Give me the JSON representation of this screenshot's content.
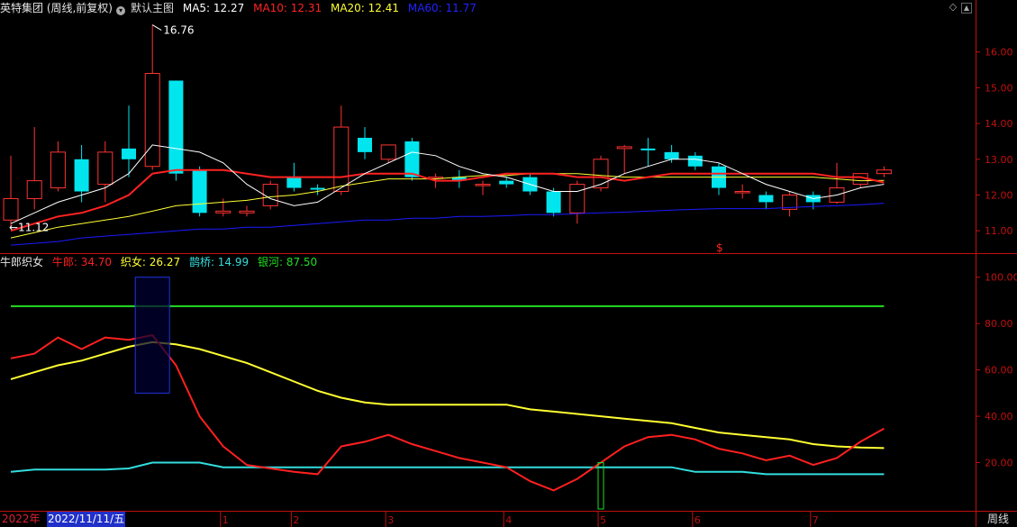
{
  "header": {
    "stock_name": "英特集团 (周线,前复权)",
    "chart_label": "默认主图",
    "ma5": "MA5: 12.27",
    "ma10": "MA10: 12.31",
    "ma20": "MA20: 12.41",
    "ma60": "MA60: 11.77"
  },
  "indicator_header": {
    "name": "牛郎织女",
    "niulang": "牛郎: 34.70",
    "zhinv": "织女: 26.27",
    "queqiao": "鹊桥: 14.99",
    "yinhe": "银河: 87.50"
  },
  "footer": {
    "start_label": "2022年",
    "cursor_date": "2022/11/11/五",
    "period_label": "周线",
    "month_ticks": [
      "1",
      "2",
      "3",
      "4",
      "5",
      "6",
      "7"
    ]
  },
  "colors": {
    "up": "#ff3333",
    "down": "#00e5ee",
    "ma5": "#ffffff",
    "ma10": "#ff2222",
    "ma20": "#ffff33",
    "ma60": "#1a1aff",
    "niulang": "#ff2020",
    "zhinv": "#ffff33",
    "queqiao": "#33dddd",
    "yinhe": "#22dd22",
    "axis": "#c01010"
  },
  "chart_data": [
    {
      "type": "candlestick",
      "title": "英特集团 (周线,前复权)",
      "price_axis_ticks": [
        11.0,
        12.0,
        13.0,
        14.0,
        15.0,
        16.0
      ],
      "ylim": [
        10.4,
        16.95
      ],
      "annotations": {
        "high": "16.76",
        "low": "11.12",
        "marker": "$"
      },
      "ohlc": [
        [
          11.3,
          11.9,
          11.12,
          13.1
        ],
        [
          11.9,
          12.4,
          11.6,
          13.9
        ],
        [
          12.2,
          13.2,
          12.1,
          13.5
        ],
        [
          13.0,
          12.1,
          11.8,
          13.4
        ],
        [
          12.3,
          13.2,
          11.8,
          13.5
        ],
        [
          13.3,
          13.0,
          12.5,
          14.5
        ],
        [
          12.8,
          15.4,
          12.7,
          16.76
        ],
        [
          15.2,
          12.6,
          12.4,
          15.2
        ],
        [
          12.7,
          11.5,
          11.4,
          12.8
        ],
        [
          11.5,
          11.55,
          11.4,
          11.9
        ],
        [
          11.5,
          11.55,
          11.4,
          11.7
        ],
        [
          11.7,
          12.3,
          11.6,
          12.4
        ],
        [
          12.5,
          12.2,
          12.1,
          12.9
        ],
        [
          12.2,
          12.15,
          12.0,
          12.3
        ],
        [
          12.1,
          13.9,
          12.0,
          14.5
        ],
        [
          13.6,
          13.2,
          13.0,
          13.9
        ],
        [
          13.0,
          13.4,
          12.9,
          13.4
        ],
        [
          13.5,
          12.5,
          12.4,
          13.6
        ],
        [
          12.5,
          12.5,
          12.2,
          12.6
        ],
        [
          12.5,
          12.4,
          12.2,
          12.7
        ],
        [
          12.3,
          12.3,
          12.0,
          12.4
        ],
        [
          12.4,
          12.3,
          12.2,
          12.5
        ],
        [
          12.5,
          12.1,
          12.0,
          12.6
        ],
        [
          12.1,
          11.5,
          11.4,
          12.2
        ],
        [
          11.5,
          12.3,
          11.2,
          12.4
        ],
        [
          12.2,
          13.0,
          12.1,
          13.1
        ],
        [
          13.3,
          13.35,
          12.6,
          13.4
        ],
        [
          13.3,
          13.25,
          12.8,
          13.6
        ],
        [
          13.2,
          13.0,
          12.9,
          13.4
        ],
        [
          13.1,
          12.8,
          12.7,
          13.2
        ],
        [
          12.8,
          12.2,
          12.0,
          12.9
        ],
        [
          12.1,
          12.1,
          11.9,
          12.3
        ],
        [
          12.0,
          11.8,
          11.6,
          12.1
        ],
        [
          11.6,
          12.0,
          11.4,
          12.1
        ],
        [
          12.0,
          11.8,
          11.6,
          12.1
        ],
        [
          11.8,
          12.2,
          11.75,
          12.9
        ],
        [
          12.3,
          12.6,
          12.2,
          12.6
        ],
        [
          12.6,
          12.7,
          12.5,
          12.8
        ]
      ],
      "ma5": [
        11.2,
        11.5,
        11.8,
        12.0,
        12.2,
        12.6,
        13.4,
        13.3,
        13.2,
        12.9,
        12.3,
        11.9,
        11.7,
        11.8,
        12.2,
        12.6,
        12.9,
        13.2,
        13.1,
        12.8,
        12.6,
        12.5,
        12.3,
        12.1,
        12.1,
        12.3,
        12.6,
        12.8,
        13.0,
        13.0,
        12.9,
        12.6,
        12.3,
        12.1,
        11.9,
        12.0,
        12.2,
        12.3
      ],
      "ma10": [
        11.0,
        11.2,
        11.4,
        11.5,
        11.7,
        12.0,
        12.6,
        12.7,
        12.7,
        12.7,
        12.6,
        12.5,
        12.5,
        12.5,
        12.5,
        12.6,
        12.6,
        12.6,
        12.4,
        12.4,
        12.5,
        12.6,
        12.6,
        12.6,
        12.5,
        12.5,
        12.4,
        12.5,
        12.6,
        12.6,
        12.6,
        12.6,
        12.6,
        12.6,
        12.6,
        12.5,
        12.5,
        12.35
      ],
      "ma20": [
        10.8,
        10.95,
        11.1,
        11.2,
        11.3,
        11.4,
        11.55,
        11.7,
        11.75,
        11.8,
        11.85,
        11.95,
        12.0,
        12.1,
        12.25,
        12.35,
        12.45,
        12.45,
        12.45,
        12.5,
        12.55,
        12.55,
        12.6,
        12.6,
        12.6,
        12.55,
        12.5,
        12.5,
        12.5,
        12.5,
        12.5,
        12.5,
        12.5,
        12.5,
        12.5,
        12.45,
        12.4,
        12.41
      ],
      "ma60": [
        10.6,
        10.65,
        10.7,
        10.8,
        10.85,
        10.9,
        10.95,
        11.0,
        11.05,
        11.05,
        11.1,
        11.1,
        11.15,
        11.2,
        11.25,
        11.3,
        11.3,
        11.35,
        11.35,
        11.4,
        11.4,
        11.42,
        11.45,
        11.45,
        11.48,
        11.5,
        11.52,
        11.55,
        11.58,
        11.6,
        11.62,
        11.62,
        11.62,
        11.65,
        11.68,
        11.7,
        11.73,
        11.77
      ]
    },
    {
      "type": "line",
      "title": "牛郎织女",
      "y_axis_ticks": [
        20.0,
        40.0,
        60.0,
        80.0,
        100.0
      ],
      "ylim": [
        0,
        103
      ],
      "series": [
        {
          "name": "牛郎",
          "values": [
            65,
            67,
            74,
            69,
            74,
            73,
            75,
            62,
            40,
            27,
            19,
            17.5,
            16,
            15,
            27,
            29,
            32,
            28,
            25,
            22,
            20,
            18,
            12,
            8,
            13,
            20,
            27,
            31,
            32,
            30,
            26,
            24,
            21,
            23,
            19,
            22,
            29,
            34.7
          ]
        },
        {
          "name": "织女",
          "values": [
            56,
            59,
            62,
            64,
            67,
            70,
            72,
            71,
            69,
            66,
            63,
            59,
            55,
            51,
            48,
            46,
            45,
            45,
            45,
            45,
            45,
            45,
            43,
            42,
            41,
            40,
            39,
            38,
            37,
            35,
            33,
            32,
            31,
            30,
            28,
            27,
            26.5,
            26.27
          ]
        },
        {
          "name": "鹊桥",
          "values": [
            16,
            17,
            17,
            17,
            17,
            17.5,
            20,
            20,
            20,
            18,
            18,
            18,
            18,
            18,
            18,
            18,
            18,
            18,
            18,
            18,
            18,
            18,
            18,
            18,
            18,
            18,
            18,
            18,
            18,
            16,
            16,
            16,
            15,
            15,
            15,
            15,
            14.99,
            14.99
          ]
        },
        {
          "name": "银河",
          "values": [
            87.5,
            87.5,
            87.5,
            87.5,
            87.5,
            87.5,
            87.5,
            87.5,
            87.5,
            87.5,
            87.5,
            87.5,
            87.5,
            87.5,
            87.5,
            87.5,
            87.5,
            87.5,
            87.5,
            87.5,
            87.5,
            87.5,
            87.5,
            87.5,
            87.5,
            87.5,
            87.5,
            87.5,
            87.5,
            87.5,
            87.5,
            87.5,
            87.5,
            87.5,
            87.5,
            87.5,
            87.5,
            87.5
          ]
        }
      ],
      "highlight_boxes": [
        {
          "index": 6,
          "from": 50,
          "to": 100
        },
        {
          "index": 25,
          "from": 0,
          "to": 20
        }
      ]
    }
  ]
}
